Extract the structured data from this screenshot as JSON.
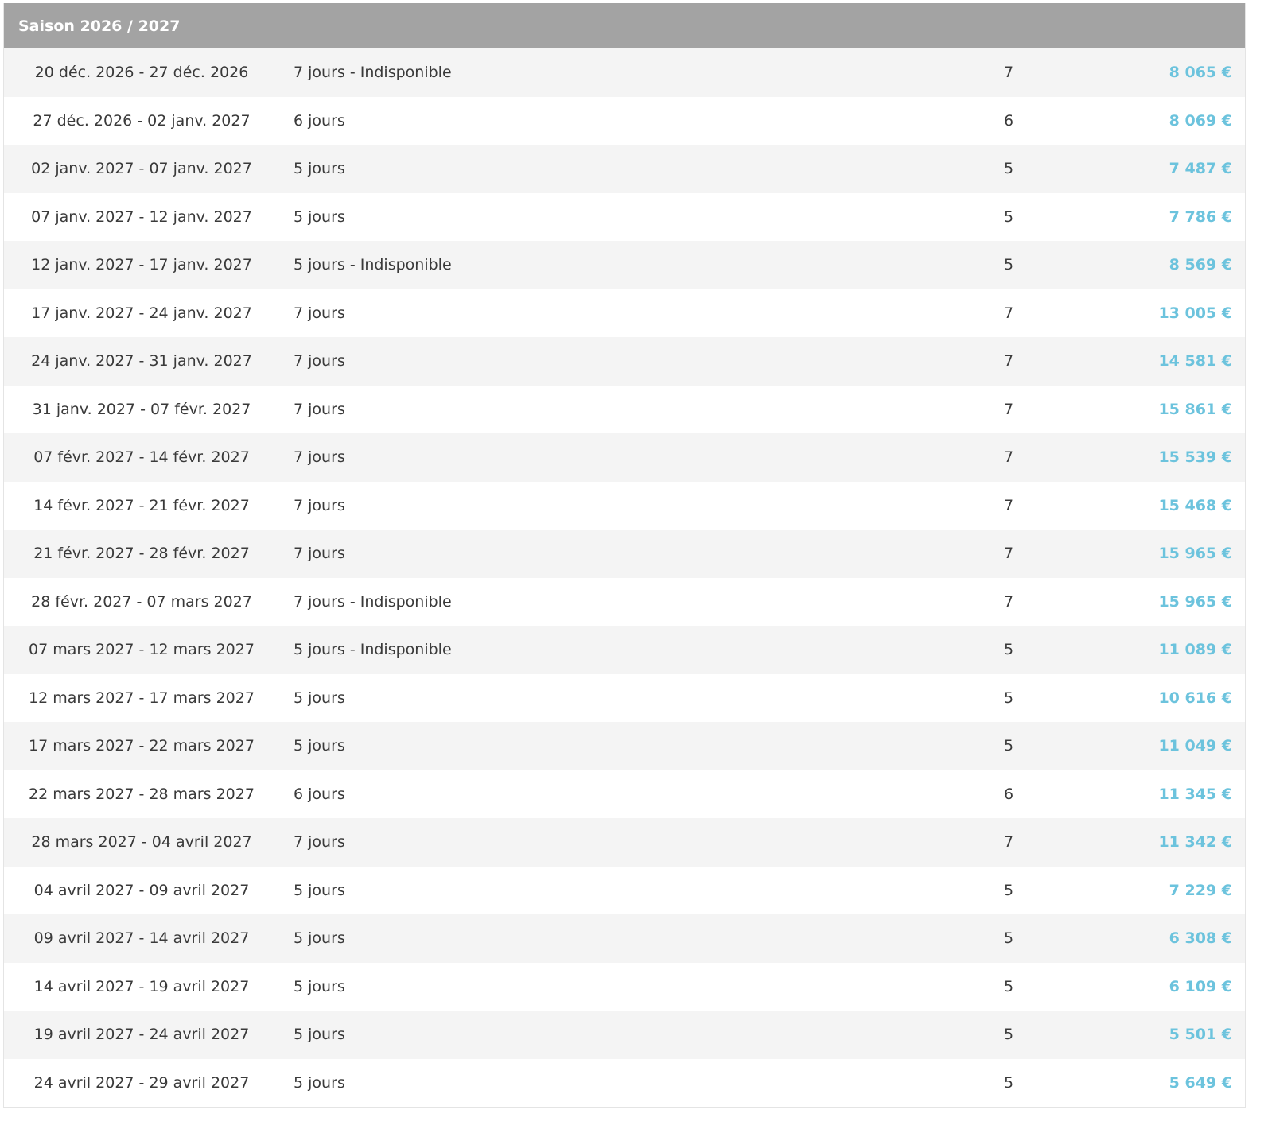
{
  "season": {
    "title": "Saison 2026 / 2027"
  },
  "colors": {
    "header_background": "#a3a3a3",
    "row_alternate": "#f4f4f4",
    "price": "#6cc3dd"
  },
  "rows": [
    {
      "dates": "20 déc. 2026  -  27 déc. 2026",
      "duration": "7 jours - Indisponible",
      "nights": "7",
      "price": "8 065 €"
    },
    {
      "dates": "27 déc. 2026  -  02 janv. 2027",
      "duration": "6 jours",
      "nights": "6",
      "price": "8 069 €"
    },
    {
      "dates": "02 janv. 2027  -  07 janv. 2027",
      "duration": "5 jours",
      "nights": "5",
      "price": "7 487 €"
    },
    {
      "dates": "07 janv. 2027  -  12 janv. 2027",
      "duration": "5 jours",
      "nights": "5",
      "price": "7 786 €"
    },
    {
      "dates": "12 janv. 2027  -  17 janv. 2027",
      "duration": "5 jours - Indisponible",
      "nights": "5",
      "price": "8 569 €"
    },
    {
      "dates": "17 janv. 2027  -  24 janv. 2027",
      "duration": "7 jours",
      "nights": "7",
      "price": "13 005 €"
    },
    {
      "dates": "24 janv. 2027  -  31 janv. 2027",
      "duration": "7 jours",
      "nights": "7",
      "price": "14 581 €"
    },
    {
      "dates": "31 janv. 2027  -  07 févr. 2027",
      "duration": "7 jours",
      "nights": "7",
      "price": "15 861 €"
    },
    {
      "dates": "07 févr. 2027  -  14 févr. 2027",
      "duration": "7 jours",
      "nights": "7",
      "price": "15 539 €"
    },
    {
      "dates": "14 févr. 2027  -  21 févr. 2027",
      "duration": "7 jours",
      "nights": "7",
      "price": "15 468 €"
    },
    {
      "dates": "21 févr. 2027  -  28 févr. 2027",
      "duration": "7 jours",
      "nights": "7",
      "price": "15 965 €"
    },
    {
      "dates": "28 févr. 2027  -  07 mars 2027",
      "duration": "7 jours - Indisponible",
      "nights": "7",
      "price": "15 965 €"
    },
    {
      "dates": "07 mars 2027  -  12 mars 2027",
      "duration": "5 jours - Indisponible",
      "nights": "5",
      "price": "11 089 €"
    },
    {
      "dates": "12 mars 2027  -  17 mars 2027",
      "duration": "5 jours",
      "nights": "5",
      "price": "10 616 €"
    },
    {
      "dates": "17 mars 2027  -  22 mars 2027",
      "duration": "5 jours",
      "nights": "5",
      "price": "11 049 €"
    },
    {
      "dates": "22 mars 2027  -  28 mars 2027",
      "duration": "6 jours",
      "nights": "6",
      "price": "11 345 €"
    },
    {
      "dates": "28 mars 2027  -  04 avril 2027",
      "duration": "7 jours",
      "nights": "7",
      "price": "11 342 €"
    },
    {
      "dates": "04 avril 2027  -  09 avril 2027",
      "duration": "5 jours",
      "nights": "5",
      "price": "7 229 €"
    },
    {
      "dates": "09 avril 2027  -  14 avril 2027",
      "duration": "5 jours",
      "nights": "5",
      "price": "6 308 €"
    },
    {
      "dates": "14 avril 2027  -  19 avril 2027",
      "duration": "5 jours",
      "nights": "5",
      "price": "6 109 €"
    },
    {
      "dates": "19 avril 2027  -  24 avril 2027",
      "duration": "5 jours",
      "nights": "5",
      "price": "5 501 €"
    },
    {
      "dates": "24 avril 2027  -  29 avril 2027",
      "duration": "5 jours",
      "nights": "5",
      "price": "5 649 €"
    }
  ]
}
